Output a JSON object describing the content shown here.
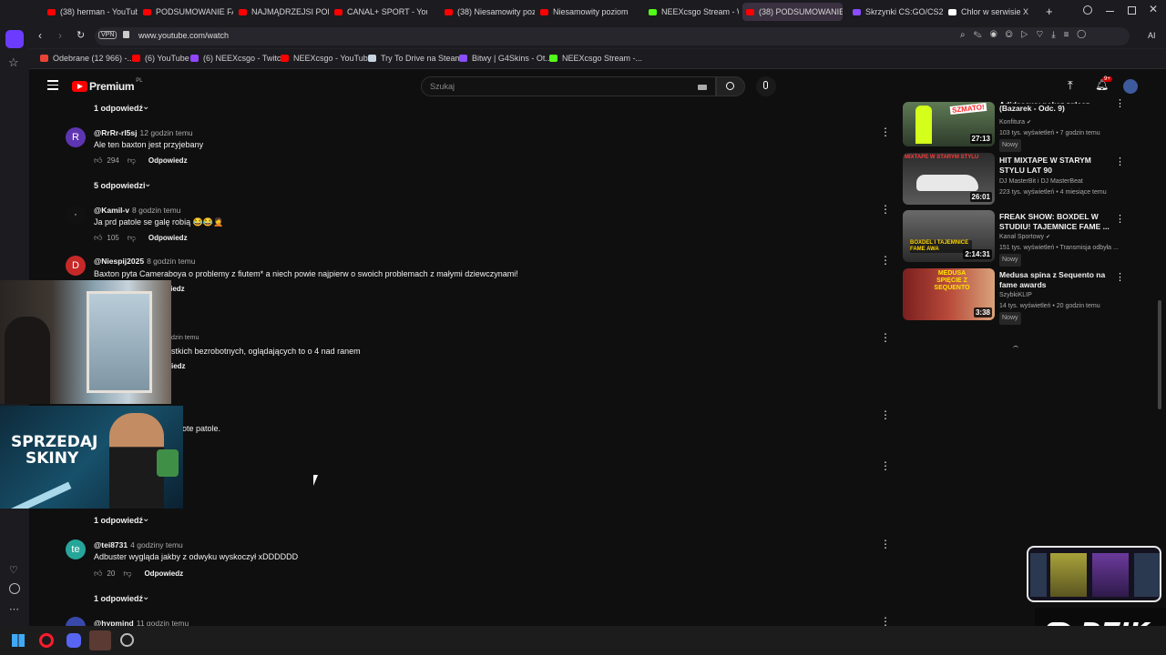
{
  "tabs": [
    {
      "label": "(38) herman - YouTube"
    },
    {
      "label": "PODSUMOWANIE FAME"
    },
    {
      "label": "NAJMĄDRZEJSI POLITYC"
    },
    {
      "label": "CANAL+ SPORT - YouTu"
    },
    {
      "label": "(38) Niesamowity pozio"
    },
    {
      "label": "Niesamowity poziom ag"
    },
    {
      "label": "NEEXcsgo Stream - Wat"
    },
    {
      "label": "(38) PODSUMOWANIE FA"
    },
    {
      "label": "Skrzynki CS:GO/CS2 | G"
    },
    {
      "label": "Chlor w serwisie X"
    }
  ],
  "address": {
    "vpn": "VPN",
    "url": "www.youtube.com/watch",
    "ai": "AI"
  },
  "bookmarks": [
    {
      "label": "Odebrane (12 966) -..."
    },
    {
      "label": "(6) YouTube"
    },
    {
      "label": "(6) NEEXcsgo - Twitch"
    },
    {
      "label": "NEEXcsgo - YouTube"
    },
    {
      "label": "Try To Drive na Steam"
    },
    {
      "label": "Bitwy | G4Skins - Ot..."
    },
    {
      "label": "NEEXcsgo Stream -..."
    }
  ],
  "header": {
    "logo": "Premium",
    "logo_region": "PL",
    "search_placeholder": "Szukaj",
    "notif_count": "9+"
  },
  "comments": [
    {
      "replies_above": "1 odpowiedź"
    },
    {
      "avatar": "R",
      "author": "@RrRr-rl5sj",
      "time": "12 godzin temu",
      "text": "Ale ten baxton jest przyjebany",
      "likes": "294",
      "reply": "Odpowiedz",
      "replies": "5 odpowiedzi"
    },
    {
      "avatar": "·",
      "author": "@Kamil-v",
      "time": "8 godzin temu",
      "text": "Ja prd patole se galę robią 😂😂🤦",
      "likes": "105",
      "reply": "Odpowiedz"
    },
    {
      "avatar": "D",
      "author": "@Niespij2025",
      "time": "8 godzin temu",
      "text": "Baxton pyta Cameraboya o problemy z fiutem* a niech powie najpierw o swoich problemach z małymi dziewczynami!",
      "reply": "Odpowiedz"
    },
    {
      "time_partial": "dzin temu",
      "text_partial": "stkich bezrobotnych, oglądających to o 4 nad ranem",
      "reply_partial": "iedz"
    },
    {
      "text_partial": "ote patole."
    },
    {
      "replies": "1 odpowiedź"
    },
    {
      "avatar": "te",
      "author": "@tei8731",
      "time": "4 godziny temu",
      "text": "Adbuster wygląda jakby z odwyku wyskoczył xDDDDDD",
      "likes": "20",
      "reply": "Odpowiedz",
      "replies": "1 odpowiedź"
    },
    {
      "author": "@hypmind",
      "time": "11 godzin temu"
    }
  ],
  "recommendations": [
    {
      "title_top": "Adidasowy pokaz zgłasz",
      "title": "(Bazarek - Odc. 9)",
      "channel": "Konfitura",
      "meta": "103 tys. wyświetleń • 7 godzin temu",
      "badge": "Nowy",
      "duration": "27:13",
      "thumb_text": "SZMATO!"
    },
    {
      "title": "HIT MIXTAPE W STARYM STYLU LAT 90",
      "channel": "DJ MasterBit i DJ MasterBeat",
      "meta": "223 tys. wyświetleń • 4 miesiące temu",
      "duration": "26:01",
      "thumb_text": "MIXTAPE W STARYM STYLU"
    },
    {
      "title": "FREAK SHOW: BOXDEL W STUDIU! TAJEMNICE FAME ...",
      "channel": "Kanał Sportowy",
      "meta": "151 tys. wyświetleń • Transmisja odbyła ...",
      "badge": "Nowy",
      "duration": "2:14:31",
      "thumb_text": "BOXDEL I TAJEMNICE FAME AWA"
    },
    {
      "title": "Medusa spina z Sequento na fame awards",
      "channel": "SzybkiKLIP",
      "meta": "14 tys. wyświetleń • 20 godzin temu",
      "badge": "Nowy",
      "duration": "3:38",
      "thumb_text": "MEDUSA SPIĘCIE Z SEQUENTO"
    }
  ],
  "overlay": {
    "ad_text_1": "SPRZEDAJ",
    "ad_text_2": "SKINY",
    "brand": "DZIK"
  },
  "colors": {
    "bg": "#0f0f0f",
    "youtube_red": "#ff0000",
    "text": "#f1f1f1",
    "muted": "#aaaaaa"
  }
}
